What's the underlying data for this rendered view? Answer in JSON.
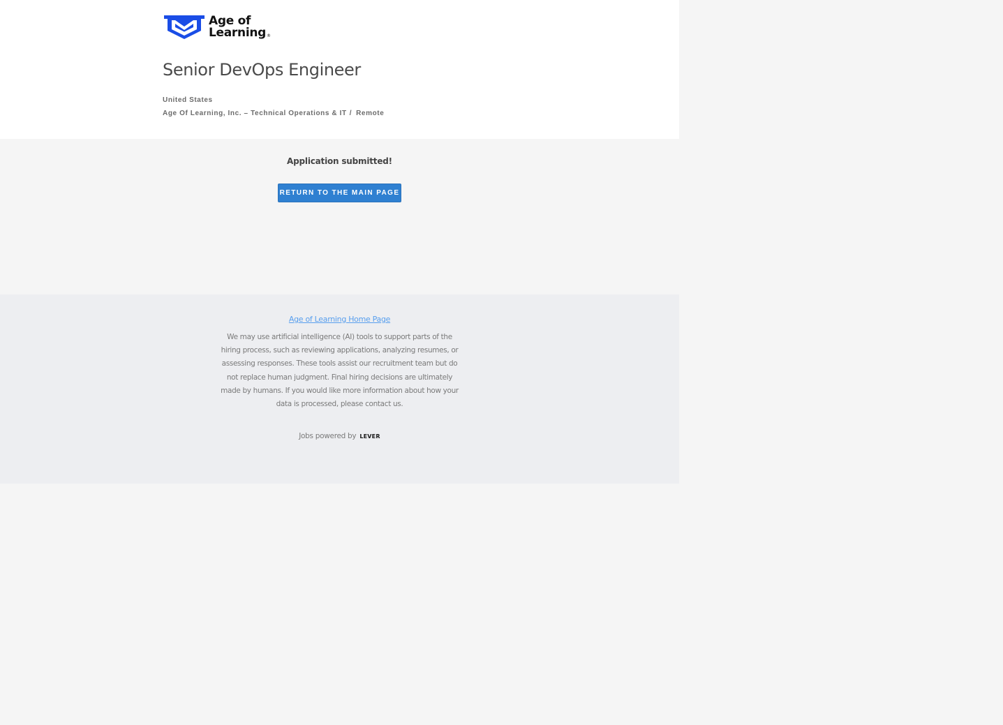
{
  "brand": {
    "name_line1": "Age of",
    "name_line2": "Learning",
    "registered_mark": "®",
    "logo_color": "#1a4de6"
  },
  "job": {
    "title": "Senior DevOps Engineer",
    "location": "United States",
    "team": "Age Of Learning, Inc. – Technical Operations & IT",
    "separator": "/",
    "commitment": "Remote"
  },
  "confirmation": {
    "message": "Application submitted!",
    "return_button_label": "RETURN TO THE MAIN PAGE",
    "button_color": "#2f80d1"
  },
  "footer": {
    "home_link_label": "Age of Learning Home Page",
    "ai_notice": "We may use artificial intelligence (AI) tools to support parts of the hiring process, such as reviewing applications, analyzing resumes, or assessing responses. These tools assist our recruitment team but do not replace human judgment. Final hiring decisions are ultimately made by humans. If you would like more information about how your data is processed, please contact us.",
    "powered_by_text": "Jobs powered by",
    "powered_by_brand": "LEVER",
    "link_color": "#579eee"
  }
}
